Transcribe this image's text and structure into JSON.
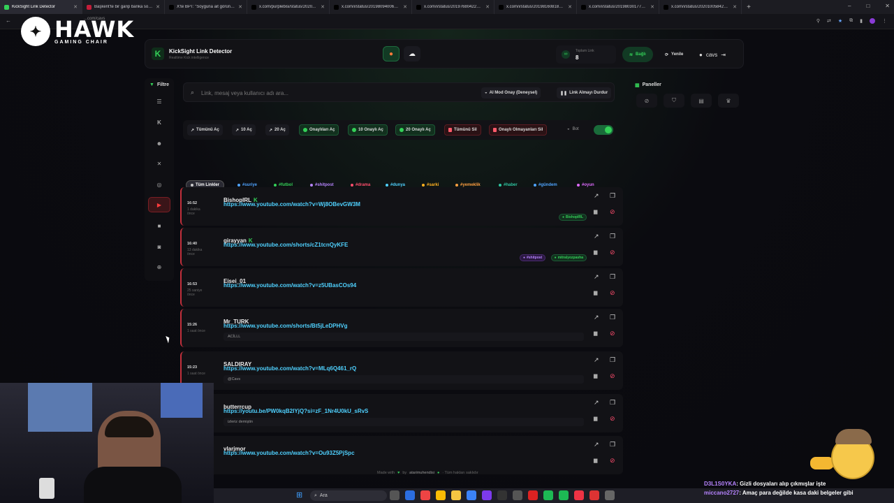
{
  "browser": {
    "tabs": [
      {
        "title": "KickSight Link Detector"
      },
      {
        "title": "Başkent'te bir garip banka soy..."
      },
      {
        "title": "X'te BPT: \"Soyguna ait görüntü..."
      },
      {
        "title": "x.com/purplebisi/status/2020..."
      },
      {
        "title": "x.com/i/status/2019809400614..."
      },
      {
        "title": "x.com/i/status/2019768042251..."
      },
      {
        "title": "x.com/i/status/2019816081800..."
      },
      {
        "title": "x.com/i/status/2019803017717..."
      },
      {
        "title": "x.com/i/status/2020100584280..."
      }
    ],
    "new_tab": "+",
    "address": "...com/cavs",
    "window_controls": [
      "–",
      "□",
      "✕"
    ]
  },
  "overlay": {
    "brand_big": "HAWK",
    "brand_small": "GAMING CHAIR"
  },
  "header": {
    "title": "KickSight Link Detector",
    "subtitle": "Realtime Kick intelligence",
    "total_label": "Toplam Link",
    "total_value": "8",
    "connected": "Bağlı",
    "refresh": "Yenile",
    "username": "cavs"
  },
  "sidebar": {
    "title": "Filtre",
    "items": [
      "list-icon",
      "kick-icon",
      "user-icon",
      "x-icon",
      "instagram-icon",
      "youtube-icon",
      "video-icon",
      "camera-icon",
      "globe-icon"
    ]
  },
  "search": {
    "placeholder": "Link, mesaj veya kullanıcı adı ara...",
    "ai_mode": "AI Mod Onay (Deneysel)",
    "stop": "Link Almayı Durdur"
  },
  "panels": {
    "title": "Paneller"
  },
  "actions": {
    "open_all": "Tümünü Aç",
    "open10": "10 Aç",
    "open20": "20 Aç",
    "open_approved": "Onaylıları Aç",
    "open10_approved": "10 Onaylı Aç",
    "open20_approved": "20 Onaylı Aç",
    "delete_all": "Tümünü Sil",
    "delete_unapproved": "Onaylı Olmayanları Sil",
    "bot": "Bot"
  },
  "tags": [
    {
      "label": "Tüm Linkler",
      "color": "#cccccc"
    },
    {
      "label": "#suriye",
      "color": "#4fa3ff"
    },
    {
      "label": "#futbol",
      "color": "#34d058"
    },
    {
      "label": "#shitpost",
      "color": "#b784ff"
    },
    {
      "label": "#drama",
      "color": "#ff4d6d"
    },
    {
      "label": "#dunya",
      "color": "#4fd1ff"
    },
    {
      "label": "#sarki",
      "color": "#ffb020"
    },
    {
      "label": "#yemeklik",
      "color": "#ff9f40"
    },
    {
      "label": "#haber",
      "color": "#2ec4a0"
    },
    {
      "label": "#gündem",
      "color": "#4fa3ff"
    },
    {
      "label": "#oyun",
      "color": "#e06bff"
    },
    {
      "label": "#edit",
      "color": "#34d058"
    },
    {
      "label": "#epstein",
      "color": "#ffb020"
    }
  ],
  "links": [
    {
      "time": "16:52",
      "ago": "1 dakika önce",
      "user": "BishopIRL",
      "kick": true,
      "url": "https://www.youtube.com/watch?v=Wj8OBevGW3M",
      "message": "",
      "badges": [
        {
          "text": "BishopIRL",
          "kind": "green"
        }
      ]
    },
    {
      "time": "16:40",
      "ago": "13 dakika önce",
      "user": "girayyan",
      "kick": true,
      "url": "https://www.youtube.com/shorts/cZ1tcnQyKFE",
      "message": "",
      "badges": [
        {
          "text": "#shitpost",
          "kind": "purple"
        },
        {
          "text": "mitralyozpasha",
          "kind": "green"
        }
      ]
    },
    {
      "time": "16:53",
      "ago": "25 saniye önce",
      "user": "Eisei_01",
      "kick": false,
      "url": "https://www.youtube.com/watch?v=z5UBasCOs94",
      "message": "",
      "badges": []
    },
    {
      "time": "15:26",
      "ago": "1 saat önce",
      "user": "Mr_TURK",
      "kick": false,
      "url": "https://www.youtube.com/shorts/Bt5jLeDPHVg",
      "message": "ACİLLL",
      "badges": []
    },
    {
      "time": "15:23",
      "ago": "1 saat önce",
      "user": "SALDIRAY",
      "kick": false,
      "url": "https://www.youtube.com/watch?v=MLq6Q461_rQ",
      "message": "@Cavs",
      "badges": []
    },
    {
      "time": "",
      "ago": "",
      "user": "butterrcup",
      "kick": false,
      "url": "https://youtu.be/PW0kqB2IYjQ?si=zF_1Nr4U0kU_sRvS",
      "message": "izleriz demiştin",
      "badges": []
    },
    {
      "time": "",
      "ago": "",
      "user": "vlarjmor",
      "kick": false,
      "url": "https://www.youtube.com/watch?v=Ou93Z5PjSpc",
      "message": "",
      "badges": []
    }
  ],
  "footer": {
    "made_with": "Made with",
    "by": "by",
    "author": "atarimuhendisi",
    "rights": "· Tüm hakları saklıdır"
  },
  "taskbar": {
    "search": "Ara"
  },
  "chat": [
    {
      "name": "D3L1S0YKA",
      "text": ": Gizli dosyaları alıp çıkmışlar işte"
    },
    {
      "name": "miccano2727",
      "text": ": Amaç para değilde kasa daki belgeler gibi"
    }
  ]
}
